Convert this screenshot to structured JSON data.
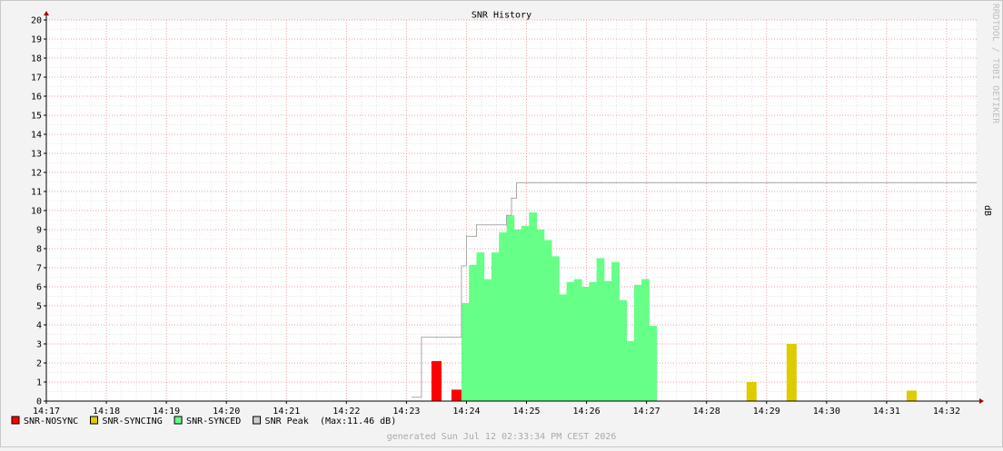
{
  "chart_data": {
    "type": "area",
    "title": "SNR History",
    "ylabel": "dB",
    "watermark": "RRDTOOL / TOBI OETIKER",
    "generated": "generated Sun Jul 12 02:33:34 PM CEST 2026",
    "xlim": [
      "14:17",
      "14:32:30"
    ],
    "ylim": [
      0,
      20
    ],
    "grid": true,
    "legend_position": "bottom-left",
    "x_ticks": [
      "14:17",
      "14:18",
      "14:19",
      "14:20",
      "14:21",
      "14:22",
      "14:23",
      "14:24",
      "14:25",
      "14:26",
      "14:27",
      "14:28",
      "14:29",
      "14:30",
      "14:31",
      "14:32"
    ],
    "y_ticks": [
      "0",
      "1",
      "2",
      "3",
      "4",
      "5",
      "6",
      "7",
      "8",
      "9",
      "10",
      "11",
      "12",
      "13",
      "14",
      "15",
      "16",
      "17",
      "18",
      "19",
      "20"
    ],
    "colors": {
      "nosync": "#ff0000",
      "syncing": "#ddcc00",
      "synced": "#66ff88",
      "peak": "#aaaaaa",
      "grid": "#e9a0a0",
      "background": "#ffffff",
      "axis": "#aa0000"
    },
    "legend": [
      {
        "label": "SNR-NOSYNC",
        "color": "#ff0000"
      },
      {
        "label": "SNR-SYNCING",
        "color": "#ddcc00"
      },
      {
        "label": "SNR-SYNCED",
        "color": "#66ff88"
      },
      {
        "label": "SNR Peak",
        "color": "#cccccc",
        "extra": "(Max:11.46 dB)"
      }
    ],
    "series": [
      {
        "name": "SNR-NOSYNC",
        "bars": [
          {
            "start": "14:23:25",
            "end": "14:23:35",
            "value": 2.1
          },
          {
            "start": "14:23:45",
            "end": "14:23:55",
            "value": 0.6
          }
        ]
      },
      {
        "name": "SNR-SYNCING",
        "bars": [
          {
            "start": "14:28:40",
            "end": "14:28:50",
            "value": 1.0
          },
          {
            "start": "14:29:20",
            "end": "14:29:30",
            "value": 3.0
          },
          {
            "start": "14:31:20",
            "end": "14:31:30",
            "value": 0.55
          }
        ]
      },
      {
        "name": "SNR-SYNCED",
        "start": "14:23:55",
        "step_seconds": 7.5,
        "values": [
          5.15,
          7.15,
          7.8,
          6.4,
          7.8,
          8.85,
          9.75,
          9.0,
          9.2,
          9.9,
          9.0,
          8.45,
          7.6,
          5.6,
          6.25,
          6.4,
          6.0,
          6.25,
          7.5,
          6.3,
          7.3,
          5.3,
          3.15,
          6.1,
          6.4,
          3.95
        ]
      },
      {
        "name": "SNR Peak",
        "points": [
          {
            "t": "14:23:05",
            "v": 0.2
          },
          {
            "t": "14:23:15",
            "v": 3.35
          },
          {
            "t": "14:23:55",
            "v": 7.1
          },
          {
            "t": "14:24:00",
            "v": 8.65
          },
          {
            "t": "14:24:10",
            "v": 9.25
          },
          {
            "t": "14:24:40",
            "v": 9.75
          },
          {
            "t": "14:24:45",
            "v": 10.65
          },
          {
            "t": "14:24:50",
            "v": 11.46
          },
          {
            "t": "14:32:30",
            "v": 11.46
          }
        ]
      }
    ]
  }
}
